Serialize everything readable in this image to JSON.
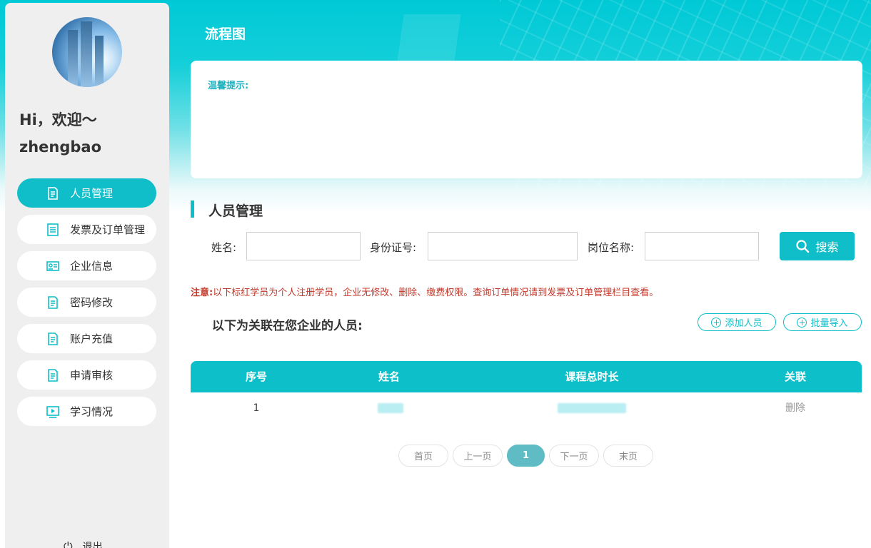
{
  "sidebar": {
    "greeting": "Hi，欢迎～",
    "username": "zhengbao",
    "items": [
      {
        "label": "人员管理",
        "icon": "document-icon",
        "active": true
      },
      {
        "label": "发票及订单管理",
        "icon": "list-doc-icon",
        "active": false
      },
      {
        "label": "企业信息",
        "icon": "id-card-icon",
        "active": false
      },
      {
        "label": "密码修改",
        "icon": "document-icon",
        "active": false
      },
      {
        "label": "账户充值",
        "icon": "document-icon",
        "active": false
      },
      {
        "label": "申请审核",
        "icon": "document-icon",
        "active": false
      },
      {
        "label": "学习情况",
        "icon": "video-icon",
        "active": false
      }
    ],
    "logout_label": "退出"
  },
  "header": {
    "title": "流程图"
  },
  "tip": {
    "label": "温馨提示:"
  },
  "section": {
    "title": "人员管理"
  },
  "search": {
    "name_label": "姓名:",
    "id_label": "身份证号:",
    "post_label": "岗位名称:",
    "name_value": "",
    "id_value": "",
    "post_value": "",
    "button_label": "搜索"
  },
  "notice": {
    "prefix": "注意:",
    "text": "以下标红学员为个人注册学员，企业无修改、删除、缴费权限。查询订单情况请到发票及订单管理栏目查看。"
  },
  "list": {
    "heading": "以下为关联在您企业的人员:",
    "add_label": "添加人员",
    "import_label": "批量导入"
  },
  "table": {
    "headers": [
      "序号",
      "姓名",
      "课程总时长",
      "关联"
    ],
    "rows": [
      {
        "index": "1",
        "name": "",
        "duration": "",
        "action": "删除"
      }
    ]
  },
  "pager": {
    "first": "首页",
    "prev": "上一页",
    "current": "1",
    "next": "下一页",
    "last": "末页"
  },
  "colors": {
    "accent": "#0fbec8",
    "notice": "#c0392b",
    "sidebar_bg": "#efefef"
  }
}
